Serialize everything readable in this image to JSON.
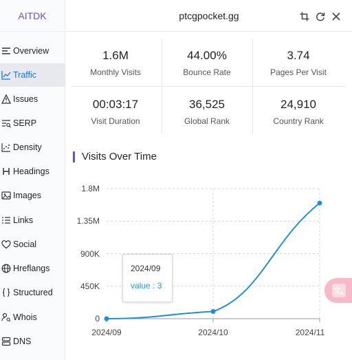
{
  "app": {
    "brand": "AITDK"
  },
  "header": {
    "domain": "ptcgpocket.gg"
  },
  "sidebar": {
    "items": [
      {
        "label": "Overview",
        "icon": "list-icon"
      },
      {
        "label": "Traffic",
        "icon": "trend-icon",
        "active": true
      },
      {
        "label": "Issues",
        "icon": "warning-icon"
      },
      {
        "label": "SERP",
        "icon": "serp-icon"
      },
      {
        "label": "Density",
        "icon": "density-icon"
      },
      {
        "label": "Headings",
        "icon": "heading-icon"
      },
      {
        "label": "Images",
        "icon": "image-icon"
      },
      {
        "label": "Links",
        "icon": "links-icon"
      },
      {
        "label": "Social",
        "icon": "heart-icon"
      },
      {
        "label": "Hreflangs",
        "icon": "globe-icon"
      },
      {
        "label": "Structured",
        "icon": "braces-icon"
      },
      {
        "label": "Whois",
        "icon": "user-search-icon"
      },
      {
        "label": "DNS",
        "icon": "server-icon"
      }
    ]
  },
  "stats": [
    {
      "value": "1.6M",
      "label": "Monthly Visits"
    },
    {
      "value": "44.00%",
      "label": "Bounce Rate"
    },
    {
      "value": "3.74",
      "label": "Pages Per Visit"
    },
    {
      "value": "00:03:17",
      "label": "Visit Duration"
    },
    {
      "value": "36,525",
      "label": "Global Rank"
    },
    {
      "value": "24,910",
      "label": "Country Rank"
    }
  ],
  "section": {
    "title": "Visits Over Time"
  },
  "tooltip": {
    "date": "2024/09",
    "value": "value : 3"
  },
  "colors": {
    "accent": "#6b4fd8",
    "line": "#1e90d8",
    "active_nav": "#1a73e8"
  },
  "chart_data": {
    "type": "line",
    "title": "Visits Over Time",
    "x": [
      "2024/09",
      "2024/10",
      "2024/11"
    ],
    "series": [
      {
        "values": [
          3,
          100000,
          1600000
        ]
      }
    ],
    "ylim": [
      0,
      1800000
    ],
    "yticks": [
      "0",
      "450K",
      "900K",
      "1.35M",
      "1.8M"
    ],
    "ytick_values": [
      0,
      450000,
      900000,
      1350000,
      1800000
    ],
    "grid": true,
    "smooth": true
  }
}
